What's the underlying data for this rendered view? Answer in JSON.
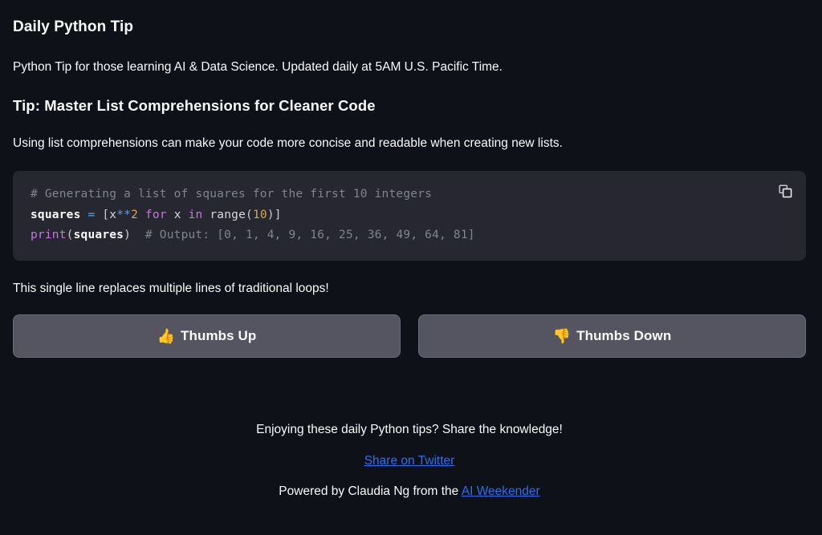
{
  "header": {
    "title": "Daily Python Tip",
    "subtitle": "Python Tip for those learning AI & Data Science. Updated daily at 5AM U.S. Pacific Time."
  },
  "tip": {
    "heading": "Tip: Master List Comprehensions for Cleaner Code",
    "intro": "Using list comprehensions can make your code more concise and readable when creating new lists.",
    "outro": "This single line replaces multiple lines of traditional loops!"
  },
  "code": {
    "line1_comment": "# Generating a list of squares for the first 10 integers",
    "line2": {
      "name": "squares",
      "eq": "=",
      "open_bracket": "[",
      "var": "x",
      "pow_op": "**",
      "pow_num": "2",
      "kw_for": "for",
      "loop_var": "x",
      "kw_in": "in",
      "fn_range": "range",
      "paren_open": "(",
      "range_num": "10",
      "paren_close": ")",
      "close_bracket": "]"
    },
    "line3": {
      "fn_print": "print",
      "paren_open": "(",
      "arg": "squares",
      "paren_close": ")",
      "comment": "# Output: [0, 1, 4, 9, 16, 25, 36, 49, 64, 81]"
    },
    "copy_icon": "copy-icon"
  },
  "buttons": {
    "thumbs_up": {
      "emoji": "👍",
      "label": "Thumbs Up",
      "icon": "thumbs-up-icon"
    },
    "thumbs_down": {
      "emoji": "👎",
      "label": "Thumbs Down",
      "icon": "thumbs-down-icon"
    }
  },
  "footer": {
    "share_prompt": "Enjoying these daily Python tips? Share the knowledge!",
    "twitter_link": "Share on Twitter",
    "powered_prefix": "Powered by Claudia Ng from the ",
    "powered_link": "AI Weekender"
  },
  "colors": {
    "background": "#0E1117",
    "code_background": "#262730",
    "button_background": "#555461",
    "link": "#2B6FF0",
    "text": "#FAFAFA",
    "comment": "#7F8493",
    "keyword": "#C678DD",
    "number": "#D9A94B",
    "operator": "#4FA6E8"
  }
}
